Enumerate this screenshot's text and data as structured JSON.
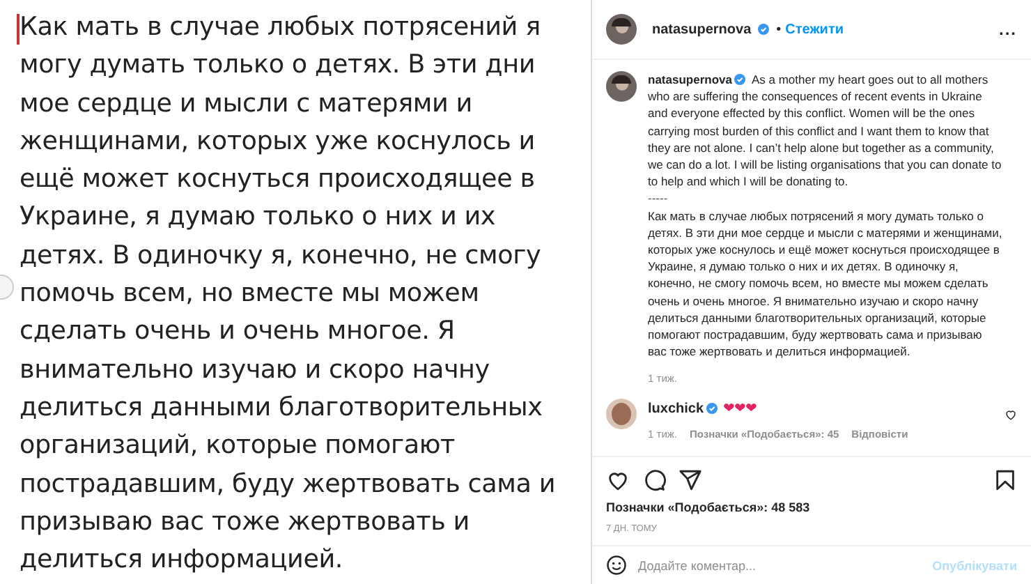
{
  "post_image": {
    "lines": [
      "Как мать в случае любых потрясений я",
      "могу думать только о детях. В эти дни",
      "мое сердце и мысли с матерями и",
      "женщинами, которых уже коснулось и",
      "ещё может коснуться происходящее в",
      "Украине, я думаю только о них и их",
      "детях. В одиночку я, конечно, не смогу",
      "помочь всем, но вместе мы можем",
      "сделать очень и очень многое. Я",
      "внимательно изучаю и скоро начну",
      "делиться данными благотворительных",
      "организаций, которые помогают",
      "пострадавшим, буду жертвовать сама и",
      "призываю вас тоже жертвовать и",
      "делиться информацией."
    ]
  },
  "header": {
    "username": "natasupernova",
    "verified": true,
    "separator": "•",
    "follow": "Стежити",
    "more": "..."
  },
  "caption": {
    "username": "natasupernova",
    "verified": true,
    "english_lines": [
      "As a mother my heart goes out to all mothers",
      "who are suffering the consequences of recent events in Ukraine and everyone effected by this conflict. Women will be the ones carrying most burden of this conflict and I want them to know that they are not alone. I can’t help alone but together as a community, we can do a lot. I will be listing organisations that you can donate to to help and which I will be donating to."
    ],
    "divider": "-----",
    "russian": "Как мать в случае любых потрясений я могу думать только о детях. В эти дни мое сердце и мысли с матерями и женщинами, которых уже коснулось и ещё может коснуться происходящее в Украине, я думаю только о них и их детях. В одиночку я, конечно, не смогу помочь всем, но вместе мы можем сделать очень и очень многое. Я внимательно изучаю и скоро начну делиться данными благотворительных организаций, которые помогают пострадавшим, буду жертвовать сама и призываю вас тоже жертвовать и делиться информацией.",
    "time": "1 тиж."
  },
  "comments": [
    {
      "username": "luxchick",
      "verified": true,
      "text": "❤❤❤",
      "time": "1 тиж.",
      "likes": "Позначки «Подобається»: 45",
      "reply": "Відповісти",
      "liked": false
    }
  ],
  "actions": {
    "liked": false,
    "saved": false
  },
  "likes": "Позначки «Подобається»: 48 583",
  "date": "7 ДН. ТОМУ",
  "comment_box": {
    "placeholder": "Додайте коментар...",
    "post": "Опублікувати"
  }
}
